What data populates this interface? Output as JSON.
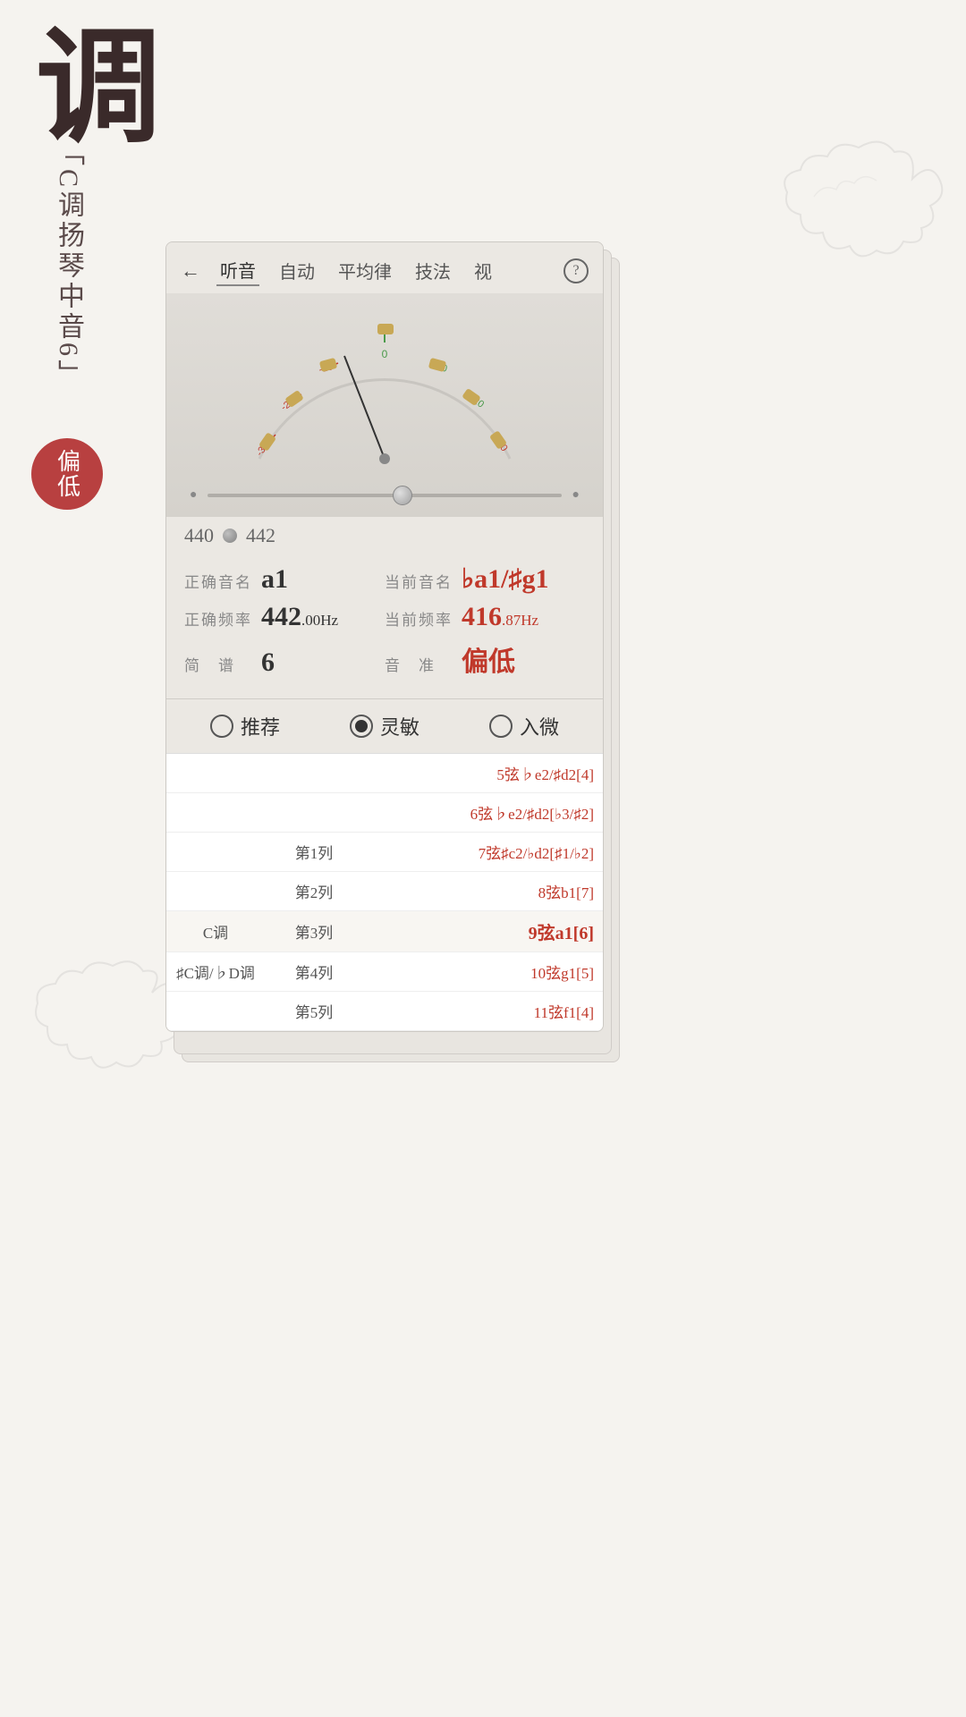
{
  "page": {
    "title_char": "调",
    "subtitle": "「C调扬琴中音6」",
    "status_badge": "偏低"
  },
  "toolbar": {
    "back_label": "←",
    "items": [
      {
        "label": "听音",
        "active": true
      },
      {
        "label": "自动",
        "active": false
      },
      {
        "label": "平均律",
        "active": false
      },
      {
        "label": "技法",
        "active": false
      },
      {
        "label": "视",
        "active": false
      }
    ],
    "help_label": "?"
  },
  "tuner": {
    "freq_left": "440",
    "freq_right": "442",
    "correct_note_label": "正确音名",
    "correct_note_value": "a1",
    "current_note_label": "当前音名",
    "current_note_value": "♭a1/♯g1",
    "correct_freq_label": "正确频率",
    "correct_freq_main": "442",
    "correct_freq_decimal": ".00",
    "correct_freq_unit": "Hz",
    "current_freq_label": "当前频率",
    "current_freq_main": "416",
    "current_freq_decimal": ".87",
    "current_freq_unit": "Hz",
    "jianpu_label": "简　谱",
    "jianpu_value": "6",
    "tuning_label": "音　准",
    "tuning_value": "偏低",
    "dial": {
      "marks_left": [
        "-30",
        "-20",
        "-10"
      ],
      "marks_right": [
        "10",
        "20",
        "30"
      ],
      "center_mark": "0"
    }
  },
  "sensitivity": {
    "options": [
      {
        "label": "推荐",
        "selected": false
      },
      {
        "label": "灵敏",
        "selected": true
      },
      {
        "label": "入微",
        "selected": false
      }
    ]
  },
  "string_table": {
    "rows": [
      {
        "key": "",
        "position": "",
        "string": "5弦♭e2/♯d2[4]",
        "highlighted": false
      },
      {
        "key": "",
        "position": "",
        "string": "6弦♭e2/♯d2[♭3/♯2]",
        "highlighted": false
      },
      {
        "key": "",
        "position": "第1列",
        "string": "7弦♯c2/♭d2[♯1/♭2]",
        "highlighted": false
      },
      {
        "key": "",
        "position": "第2列",
        "string": "8弦b1[7]",
        "highlighted": false
      },
      {
        "key": "C调",
        "position": "第3列",
        "string": "9弦a1[6]",
        "highlighted": true,
        "active": true
      },
      {
        "key": "♯C调/♭D调",
        "position": "第4列",
        "string": "10弦g1[5]",
        "highlighted": false
      },
      {
        "key": "",
        "position": "第5列",
        "string": "11弦f1[4]",
        "highlighted": false
      }
    ]
  }
}
